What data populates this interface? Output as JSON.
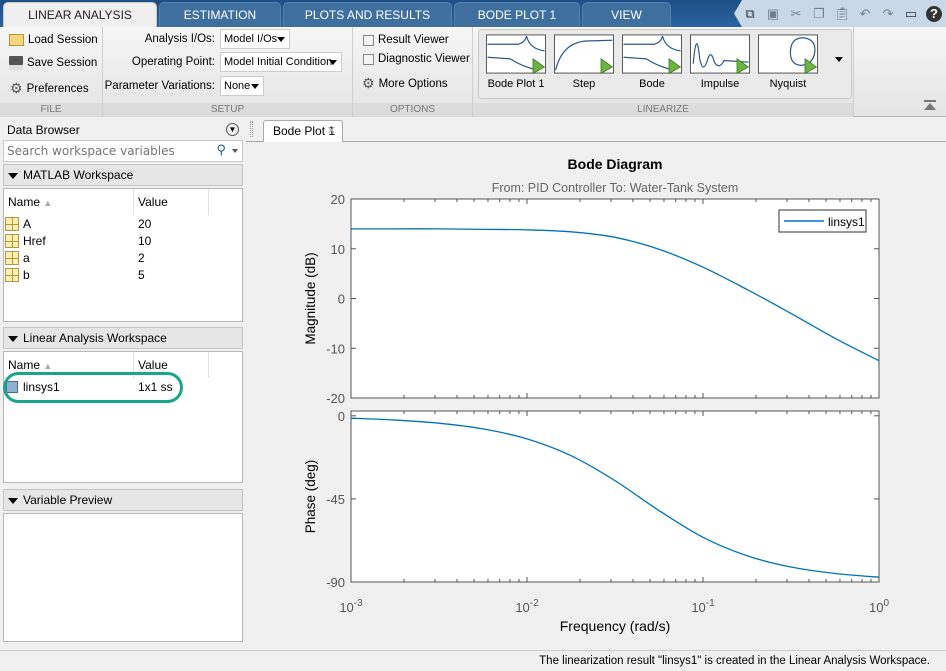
{
  "tabs": [
    {
      "label": "LINEAR ANALYSIS",
      "active": true
    },
    {
      "label": "ESTIMATION"
    },
    {
      "label": "PLOTS AND RESULTS"
    },
    {
      "label": "BODE PLOT 1"
    },
    {
      "label": "VIEW"
    }
  ],
  "quick_access": [
    "new-plot-icon",
    "save-icon",
    "cut-icon",
    "copy-icon",
    "paste-icon",
    "undo-icon",
    "redo-icon",
    "window-icon",
    "help-icon"
  ],
  "ribbon": {
    "file": {
      "label": "FILE",
      "load": "Load Session",
      "save": "Save Session",
      "prefs": "Preferences"
    },
    "setup": {
      "label": "SETUP",
      "analysis_ios_label": "Analysis I/Os:",
      "analysis_ios": "Model I/Os",
      "op_label": "Operating Point:",
      "op": "Model Initial Condition",
      "param_label": "Parameter Variations:",
      "param": "None"
    },
    "options": {
      "label": "OPTIONS",
      "result_viewer": "Result Viewer",
      "result_viewer_checked": false,
      "diag_viewer": "Diagnostic Viewer",
      "diag_viewer_checked": false,
      "more": "More Options"
    },
    "linearize": {
      "label": "LINEARIZE",
      "items": [
        "Bode Plot 1",
        "Step",
        "Bode",
        "Impulse",
        "Nyquist"
      ]
    }
  },
  "data_browser": {
    "title": "Data Browser",
    "search_placeholder": "Search workspace variables",
    "matlab_ws": {
      "title": "MATLAB Workspace",
      "col_name": "Name",
      "col_value": "Value",
      "rows": [
        {
          "name": "A",
          "value": "20"
        },
        {
          "name": "Href",
          "value": "10"
        },
        {
          "name": "a",
          "value": "2"
        },
        {
          "name": "b",
          "value": "5"
        }
      ]
    },
    "linear_ws": {
      "title": "Linear Analysis Workspace",
      "col_name": "Name",
      "col_value": "Value",
      "rows": [
        {
          "name": "linsys1",
          "value": "1x1 ss"
        }
      ]
    },
    "preview": {
      "title": "Variable Preview"
    }
  },
  "document": {
    "tab": "Bode Plot 1"
  },
  "chart_data": {
    "type": "line",
    "title": "Bode Diagram",
    "subtitle": "From: PID Controller  To: Water-Tank System",
    "xlabel": "Frequency  (rad/s)",
    "xscale": "log",
    "xlim": [
      0.001,
      1
    ],
    "xticks": [
      "10^-3",
      "10^-2",
      "10^-1",
      "10^0"
    ],
    "grid": false,
    "legend_position": "top-right",
    "line_color": "#0072bd",
    "x": [
      0.001,
      0.00178,
      0.00316,
      0.00562,
      0.01,
      0.0178,
      0.0316,
      0.0562,
      0.1,
      0.178,
      0.316,
      0.562,
      1
    ],
    "panels": [
      {
        "ylabel": "Magnitude (dB)",
        "ylim": [
          -20,
          20
        ],
        "yticks": [
          "20",
          "10",
          "0",
          "-10",
          "-20"
        ],
        "yvals": [
          20,
          10,
          0,
          -10,
          -20
        ],
        "series": [
          {
            "name": "linsys1",
            "values": [
              14.0,
              14.0,
              14.0,
              13.9,
              13.8,
              13.4,
              12.3,
              9.9,
              6.3,
              1.8,
              -3.0,
              -8.0,
              -12.5
            ]
          }
        ]
      },
      {
        "ylabel": "Phase (deg)",
        "ylim": [
          -90,
          2.6
        ],
        "yticks": [
          "0",
          "-45",
          "-90"
        ],
        "yvals": [
          0,
          -45,
          -90
        ],
        "series": [
          {
            "values": [
              -1.3,
              -2.3,
              -4.0,
              -7.1,
              -12.5,
              -21.6,
              -35.1,
              -51.3,
              -65.8,
              -75.8,
              -81.9,
              -85.4,
              -87.4
            ]
          }
        ]
      }
    ]
  },
  "status": "The linearization result \"linsys1\" is created in the Linear Analysis Workspace."
}
